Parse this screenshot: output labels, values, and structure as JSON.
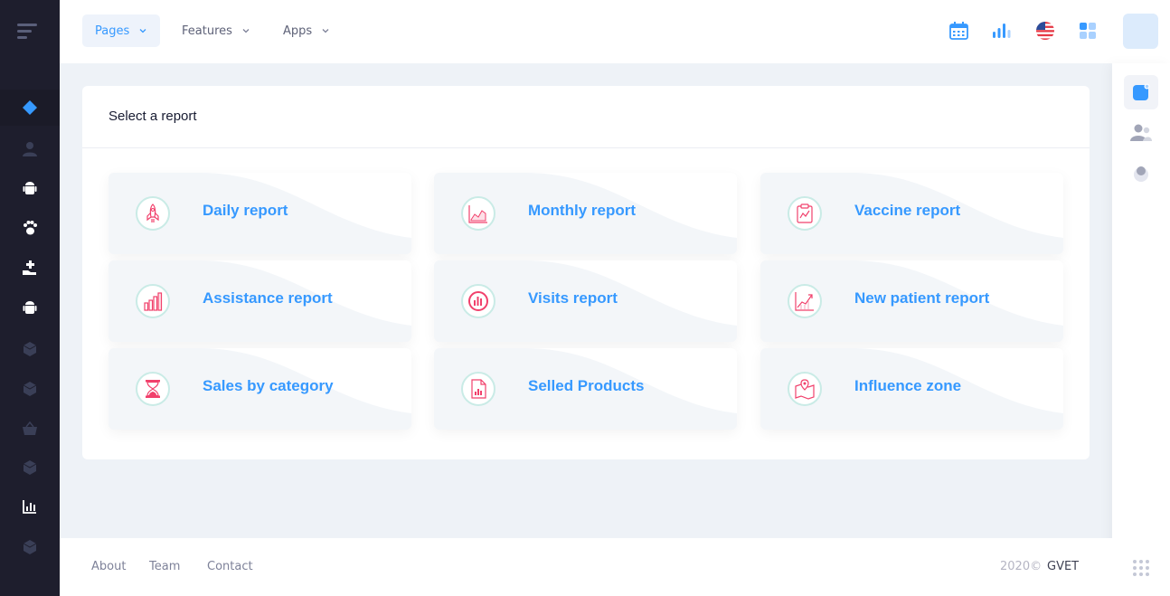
{
  "header": {
    "nav": [
      {
        "label": "Pages",
        "active": true
      },
      {
        "label": "Features",
        "active": false
      },
      {
        "label": "Apps",
        "active": false
      }
    ],
    "icons": [
      "calendar-icon",
      "bar-chart-icon",
      "us-flag-icon",
      "apps-grid-icon"
    ]
  },
  "sidebar": {
    "items": [
      {
        "icon": "layers-icon",
        "active": true
      },
      {
        "icon": "user-icon"
      },
      {
        "icon": "android-icon"
      },
      {
        "icon": "paw-icon"
      },
      {
        "icon": "hand-plus-icon"
      },
      {
        "icon": "android-icon"
      },
      {
        "icon": "box-icon"
      },
      {
        "icon": "box-icon"
      },
      {
        "icon": "basket-icon"
      },
      {
        "icon": "box-icon"
      },
      {
        "icon": "chart-icon"
      },
      {
        "icon": "box-icon"
      }
    ]
  },
  "main": {
    "title": "Select a report",
    "reports": [
      {
        "label": "Daily report",
        "icon": "rocket-icon"
      },
      {
        "label": "Monthly report",
        "icon": "area-chart-icon"
      },
      {
        "label": "Vaccine report",
        "icon": "clipboard-chart-icon"
      },
      {
        "label": "Assistance report",
        "icon": "bar-chart-icon"
      },
      {
        "label": "Visits report",
        "icon": "circle-bars-icon"
      },
      {
        "label": "New patient report",
        "icon": "growth-chart-icon"
      },
      {
        "label": "Sales by category",
        "icon": "hourglass-icon"
      },
      {
        "label": "Selled Products",
        "icon": "document-chart-icon"
      },
      {
        "label": "Influence zone",
        "icon": "map-pin-icon"
      }
    ]
  },
  "footer": {
    "links": [
      "About",
      "Team",
      "Contact"
    ],
    "copyright": "2020©",
    "brand": "GVET"
  },
  "aside": {
    "buttons": [
      "notes-icon",
      "users-icon",
      "user-circle-icon"
    ]
  },
  "colors": {
    "accent": "#3699ff",
    "icon_red": "#f1416c",
    "sidebar_bg": "#1e1e2d"
  }
}
